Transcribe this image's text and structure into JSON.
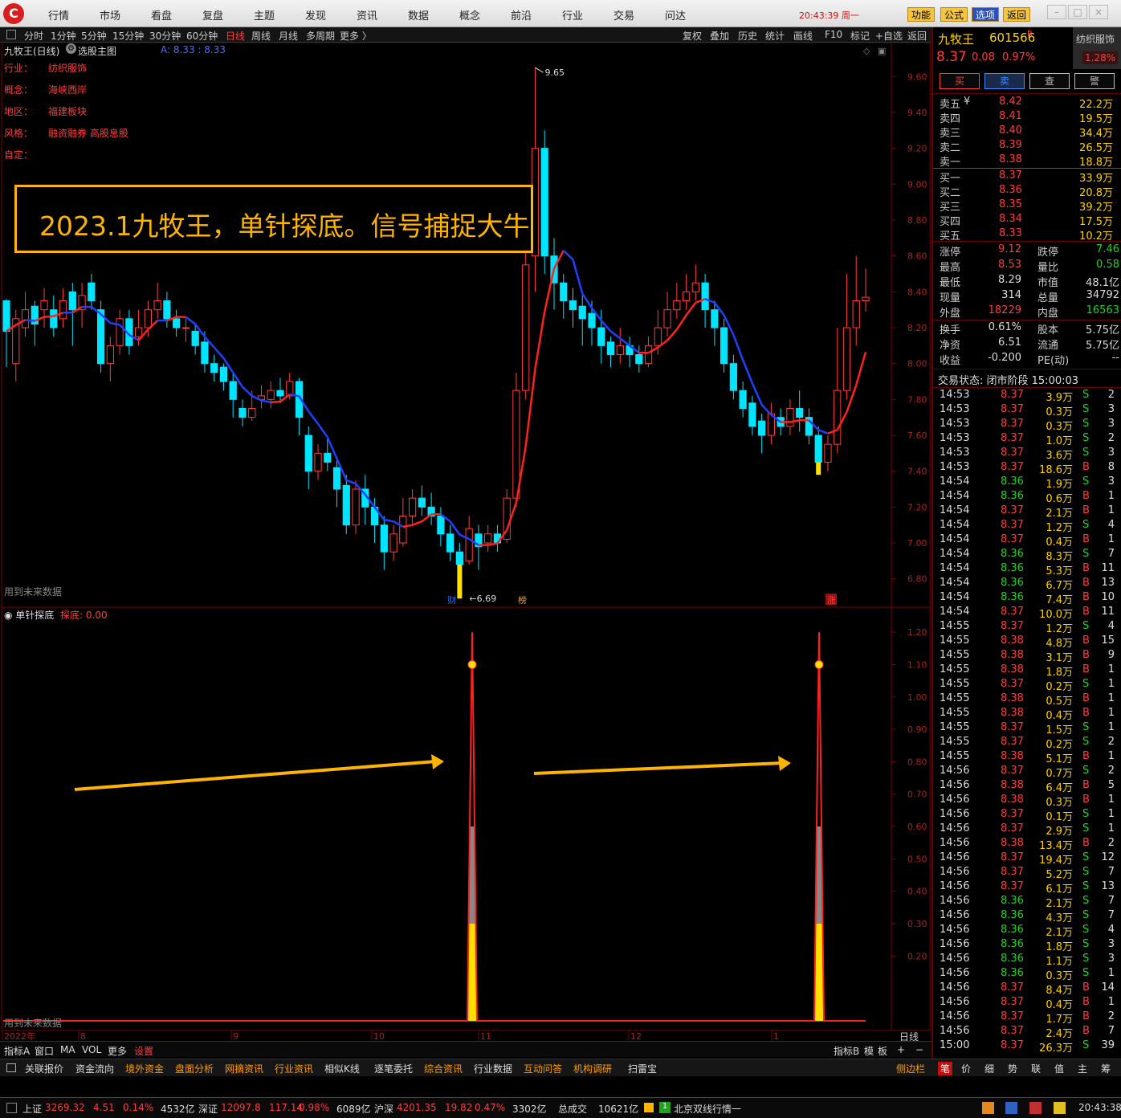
{
  "menu": [
    "行情",
    "市场",
    "看盘",
    "复盘",
    "主题",
    "发现",
    "资讯",
    "数据",
    "概念",
    "前沿",
    "行业",
    "交易",
    "问达"
  ],
  "clock": "20:43:39 周一",
  "top_buttons": [
    "功能",
    "公式",
    "选项",
    "返回"
  ],
  "periods": [
    "分时",
    "1分钟",
    "5分钟",
    "15分钟",
    "30分钟",
    "60分钟",
    "日线",
    "周线",
    "月线",
    "多周期",
    "更多 〉"
  ],
  "active_period": "日线",
  "tools": [
    "复权",
    "叠加",
    "历史",
    "统计",
    "画线",
    "F10",
    "标记",
    "+自选",
    "返回"
  ],
  "chart_title": "九牧王(日线)",
  "chart_title2": "选股主图",
  "ma_label": "A: 8.33 : 8.33",
  "info": [
    {
      "k": "行业：",
      "v": "纺织服饰"
    },
    {
      "k": "概念：",
      "v": "海峡西岸"
    },
    {
      "k": "地区：",
      "v": "福建板块"
    },
    {
      "k": "风格：",
      "v": "融资融券 高股息股"
    },
    {
      "k": "自定：",
      "v": ""
    }
  ],
  "banner": "2023.1九牧王，单针探底。信号捕捉大牛",
  "high_label": "9.65",
  "low_label": "6.69",
  "future_note": "用到未来数据",
  "markers": {
    "cai": "财",
    "bang": "榜",
    "zhang": "涨"
  },
  "ind_title": "单针探底",
  "ind_value": "探底: 0.00",
  "price_ticks": [
    "9.60",
    "9.40",
    "9.20",
    "9.00",
    "8.80",
    "8.60",
    "8.40",
    "8.20",
    "8.00",
    "7.80",
    "7.60",
    "7.40",
    "7.20",
    "7.00",
    "6.80"
  ],
  "ind_ticks": [
    "1.20",
    "1.10",
    "1.00",
    "0.90",
    "0.80",
    "0.70",
    "0.60",
    "0.50",
    "0.40",
    "0.30",
    "0.20"
  ],
  "x_labels": [
    "2022年",
    "8",
    "9",
    "10",
    "11",
    "12",
    "1"
  ],
  "period_label": "日线",
  "stock": {
    "name": "九牧王",
    "code": "601566",
    "r": "R",
    "sector": "纺织服饰",
    "price": "8.37",
    "chg": "0.08",
    "pct": "0.97%",
    "pct2": "1.28%"
  },
  "trade_buttons": [
    "买",
    "卖",
    "查",
    "警"
  ],
  "asks": [
    {
      "l": "卖五",
      "p": "8.42",
      "v": "22.2万"
    },
    {
      "l": "卖四",
      "p": "8.41",
      "v": "19.5万"
    },
    {
      "l": "卖三",
      "p": "8.40",
      "v": "34.4万"
    },
    {
      "l": "卖二",
      "p": "8.39",
      "v": "26.5万"
    },
    {
      "l": "卖一",
      "p": "8.38",
      "v": "18.8万"
    }
  ],
  "yen": "¥",
  "bids": [
    {
      "l": "买一",
      "p": "8.37",
      "v": "33.9万"
    },
    {
      "l": "买二",
      "p": "8.36",
      "v": "20.8万"
    },
    {
      "l": "买三",
      "p": "8.35",
      "v": "39.2万"
    },
    {
      "l": "买四",
      "p": "8.34",
      "v": "17.5万"
    },
    {
      "l": "买五",
      "p": "8.33",
      "v": "10.2万"
    }
  ],
  "stats": [
    [
      {
        "l": "涨停",
        "v": "9.12",
        "c": "red"
      },
      {
        "l": "跌停",
        "v": "7.46",
        "c": "green"
      }
    ],
    [
      {
        "l": "最高",
        "v": "8.53",
        "c": "red"
      },
      {
        "l": "量比",
        "v": "0.58",
        "c": "green"
      }
    ],
    [
      {
        "l": "最低",
        "v": "8.29",
        "c": "white"
      },
      {
        "l": "市值",
        "v": "48.1亿",
        "c": "white"
      }
    ],
    [
      {
        "l": "现量",
        "v": "314",
        "c": "white"
      },
      {
        "l": "总量",
        "v": "34792",
        "c": "white"
      }
    ],
    [
      {
        "l": "外盘",
        "v": "18229",
        "c": "red"
      },
      {
        "l": "内盘",
        "v": "16563",
        "c": "green"
      }
    ],
    [
      {
        "l": "换手",
        "v": "0.61%",
        "c": "white"
      },
      {
        "l": "股本",
        "v": "5.75亿",
        "c": "white"
      }
    ],
    [
      {
        "l": "净资",
        "v": "6.51",
        "c": "white"
      },
      {
        "l": "流通",
        "v": "5.75亿",
        "c": "white"
      }
    ],
    [
      {
        "l": "收益",
        "v": "-0.200",
        "c": "white"
      },
      {
        "l": "PE(动)",
        "v": "--",
        "c": "white"
      }
    ]
  ],
  "trade_state": "交易状态: 闭市阶段 15:00:03",
  "ticks": [
    [
      "14:53",
      "8.37",
      "3.9万",
      "S",
      "2"
    ],
    [
      "14:53",
      "8.37",
      "0.3万",
      "S",
      "3"
    ],
    [
      "14:53",
      "8.37",
      "0.3万",
      "S",
      "3"
    ],
    [
      "14:53",
      "8.37",
      "1.0万",
      "S",
      "2"
    ],
    [
      "14:53",
      "8.37",
      "3.6万",
      "S",
      "3"
    ],
    [
      "14:53",
      "8.37",
      "18.6万",
      "B",
      "8"
    ],
    [
      "14:54",
      "8.36",
      "1.9万",
      "S",
      "3"
    ],
    [
      "14:54",
      "8.36",
      "0.6万",
      "B",
      "1"
    ],
    [
      "14:54",
      "8.37",
      "2.1万",
      "B",
      "1"
    ],
    [
      "14:54",
      "8.37",
      "1.2万",
      "S",
      "4"
    ],
    [
      "14:54",
      "8.37",
      "0.4万",
      "B",
      "1"
    ],
    [
      "14:54",
      "8.36",
      "8.3万",
      "S",
      "7"
    ],
    [
      "14:54",
      "8.36",
      "5.3万",
      "B",
      "11"
    ],
    [
      "14:54",
      "8.36",
      "6.7万",
      "B",
      "13"
    ],
    [
      "14:54",
      "8.36",
      "7.4万",
      "B",
      "10"
    ],
    [
      "14:54",
      "8.37",
      "10.0万",
      "B",
      "11"
    ],
    [
      "14:55",
      "8.37",
      "1.2万",
      "S",
      "4"
    ],
    [
      "14:55",
      "8.38",
      "4.8万",
      "B",
      "15"
    ],
    [
      "14:55",
      "8.38",
      "3.1万",
      "B",
      "9"
    ],
    [
      "14:55",
      "8.38",
      "1.8万",
      "B",
      "1"
    ],
    [
      "14:55",
      "8.37",
      "0.2万",
      "S",
      "1"
    ],
    [
      "14:55",
      "8.38",
      "0.5万",
      "B",
      "1"
    ],
    [
      "14:55",
      "8.38",
      "0.4万",
      "B",
      "1"
    ],
    [
      "14:55",
      "8.37",
      "1.5万",
      "S",
      "1"
    ],
    [
      "14:55",
      "8.37",
      "0.2万",
      "S",
      "2"
    ],
    [
      "14:55",
      "8.38",
      "5.1万",
      "B",
      "1"
    ],
    [
      "14:56",
      "8.37",
      "0.7万",
      "S",
      "2"
    ],
    [
      "14:56",
      "8.38",
      "6.4万",
      "B",
      "5"
    ],
    [
      "14:56",
      "8.38",
      "0.3万",
      "B",
      "1"
    ],
    [
      "14:56",
      "8.37",
      "0.1万",
      "S",
      "1"
    ],
    [
      "14:56",
      "8.37",
      "2.9万",
      "S",
      "1"
    ],
    [
      "14:56",
      "8.38",
      "13.4万",
      "B",
      "2"
    ],
    [
      "14:56",
      "8.37",
      "19.4万",
      "S",
      "12"
    ],
    [
      "14:56",
      "8.37",
      "5.2万",
      "S",
      "7"
    ],
    [
      "14:56",
      "8.37",
      "6.1万",
      "S",
      "13"
    ],
    [
      "14:56",
      "8.36",
      "2.1万",
      "S",
      "7"
    ],
    [
      "14:56",
      "8.36",
      "4.3万",
      "S",
      "7"
    ],
    [
      "14:56",
      "8.36",
      "2.1万",
      "S",
      "4"
    ],
    [
      "14:56",
      "8.36",
      "1.8万",
      "S",
      "3"
    ],
    [
      "14:56",
      "8.36",
      "1.1万",
      "S",
      "3"
    ],
    [
      "14:56",
      "8.36",
      "0.3万",
      "S",
      "1"
    ],
    [
      "14:56",
      "8.37",
      "8.4万",
      "B",
      "14"
    ],
    [
      "14:56",
      "8.37",
      "0.4万",
      "B",
      "1"
    ],
    [
      "14:56",
      "8.37",
      "1.7万",
      "B",
      "2"
    ],
    [
      "14:56",
      "8.37",
      "2.4万",
      "B",
      "7"
    ],
    [
      "15:00",
      "8.37",
      "26.3万",
      "S",
      "39"
    ]
  ],
  "bottom_left": [
    "指标A",
    "窗口",
    "MA",
    "VOL",
    "更多",
    "设置"
  ],
  "bottom_right": [
    "指标B",
    "模",
    "板",
    "+",
    "−"
  ],
  "nav_tabs": [
    "关联报价",
    "资金流向",
    "境外资金",
    "盘面分析",
    "网摘资讯",
    "行业资讯",
    "相似K线",
    "逐笔委托",
    "综合资讯",
    "行业数据",
    "互动问答",
    "机构调研",
    "扫雷宝"
  ],
  "sidebar_btn": "侧边栏",
  "right_tabs": [
    "笔",
    "价",
    "细",
    "势",
    "联",
    "值",
    "主",
    "筹"
  ],
  "indices": [
    {
      "n": "上证",
      "v": "3269.32",
      "d": "4.51",
      "p": "0.14%",
      "a": "4532亿"
    },
    {
      "n": "深证",
      "v": "12097.8",
      "d": "117.14",
      "p": "0.98%",
      "a": "6089亿"
    },
    {
      "n": "沪深",
      "v": "4201.35",
      "d": "19.82",
      "p": "0.47%",
      "a": "3302亿"
    }
  ],
  "total_label": "总成交",
  "total_val": "10621亿",
  "ticker": "北京双线行情一",
  "status_time": "20:43:38",
  "chart_data": {
    "type": "candlestick",
    "pane_price": {
      "ymin": 6.7,
      "ymax": 9.7
    },
    "pane_indicator": {
      "ymin": 0,
      "ymax": 1.24
    },
    "candles": [
      [
        8.35,
        8.18,
        7.98,
        8.36
      ],
      [
        8.0,
        8.25,
        7.9,
        8.3
      ],
      [
        8.2,
        8.3,
        8.15,
        8.4
      ],
      [
        8.32,
        8.22,
        8.1,
        8.35
      ],
      [
        8.3,
        8.35,
        8.2,
        8.42
      ],
      [
        8.3,
        8.2,
        8.15,
        8.38
      ],
      [
        8.25,
        8.35,
        8.2,
        8.42
      ],
      [
        8.4,
        8.3,
        8.1,
        8.45
      ],
      [
        8.3,
        8.38,
        8.2,
        8.45
      ],
      [
        8.45,
        8.35,
        8.3,
        8.5
      ],
      [
        8.3,
        8.0,
        7.95,
        8.35
      ],
      [
        8.0,
        8.1,
        7.9,
        8.15
      ],
      [
        8.1,
        8.25,
        8.05,
        8.3
      ],
      [
        8.25,
        8.1,
        8.05,
        8.3
      ],
      [
        8.15,
        8.2,
        8.1,
        8.3
      ],
      [
        8.2,
        8.3,
        8.15,
        8.35
      ],
      [
        8.3,
        8.35,
        8.25,
        8.45
      ],
      [
        8.35,
        8.25,
        8.2,
        8.4
      ],
      [
        8.25,
        8.2,
        8.15,
        8.3
      ],
      [
        8.2,
        8.2,
        8.12,
        8.25
      ],
      [
        8.18,
        8.1,
        8.05,
        8.22
      ],
      [
        8.12,
        8.0,
        7.95,
        8.18
      ],
      [
        8.0,
        7.95,
        7.9,
        8.05
      ],
      [
        7.98,
        7.9,
        7.85,
        8.0
      ],
      [
        7.9,
        7.8,
        7.7,
        7.95
      ],
      [
        7.75,
        7.7,
        7.65,
        7.8
      ],
      [
        7.7,
        7.75,
        7.68,
        7.85
      ],
      [
        7.8,
        7.82,
        7.75,
        7.88
      ],
      [
        7.8,
        7.85,
        7.75,
        7.9
      ],
      [
        7.85,
        7.82,
        7.78,
        7.92
      ],
      [
        7.82,
        7.9,
        7.8,
        7.95
      ],
      [
        7.9,
        7.7,
        7.6,
        7.92
      ],
      [
        7.6,
        7.4,
        7.3,
        7.65
      ],
      [
        7.4,
        7.5,
        7.35,
        7.55
      ],
      [
        7.5,
        7.45,
        7.4,
        7.58
      ],
      [
        7.42,
        7.3,
        7.2,
        7.48
      ],
      [
        7.32,
        7.1,
        7.05,
        7.38
      ],
      [
        7.1,
        7.3,
        7.05,
        7.35
      ],
      [
        7.3,
        7.2,
        7.1,
        7.38
      ],
      [
        7.2,
        7.1,
        7.0,
        7.25
      ],
      [
        7.1,
        6.95,
        6.85,
        7.15
      ],
      [
        6.95,
        7.05,
        6.9,
        7.1
      ],
      [
        7.0,
        7.15,
        6.98,
        7.25
      ],
      [
        7.15,
        7.25,
        7.1,
        7.3
      ],
      [
        7.25,
        7.2,
        7.15,
        7.32
      ],
      [
        7.2,
        7.15,
        7.1,
        7.28
      ],
      [
        7.15,
        7.05,
        6.98,
        7.2
      ],
      [
        7.05,
        6.95,
        6.9,
        7.1
      ],
      [
        6.95,
        6.88,
        6.8,
        7.0
      ],
      [
        6.9,
        7.08,
        6.88,
        7.15
      ],
      [
        7.05,
        6.98,
        6.85,
        7.1
      ],
      [
        7.0,
        7.05,
        6.95,
        7.1
      ],
      [
        7.05,
        7.0,
        6.95,
        7.1
      ],
      [
        7.02,
        7.25,
        7.0,
        7.3
      ],
      [
        7.25,
        7.85,
        7.2,
        7.95
      ],
      [
        7.85,
        8.55,
        7.8,
        8.65
      ],
      [
        8.6,
        9.2,
        8.4,
        9.65
      ],
      [
        9.2,
        8.6,
        8.5,
        9.3
      ],
      [
        8.6,
        8.45,
        8.3,
        8.7
      ],
      [
        8.45,
        8.35,
        8.25,
        8.5
      ],
      [
        8.35,
        8.3,
        8.2,
        8.42
      ],
      [
        8.32,
        8.25,
        8.1,
        8.38
      ],
      [
        8.28,
        8.2,
        8.1,
        8.35
      ],
      [
        8.2,
        8.1,
        8.0,
        8.3
      ],
      [
        8.12,
        8.05,
        7.98,
        8.15
      ],
      [
        8.05,
        8.1,
        8.0,
        8.2
      ],
      [
        8.1,
        8.05,
        7.98,
        8.15
      ],
      [
        8.05,
        8.0,
        7.95,
        8.1
      ],
      [
        8.0,
        8.1,
        7.98,
        8.15
      ],
      [
        8.1,
        8.2,
        8.05,
        8.3
      ],
      [
        8.2,
        8.3,
        8.15,
        8.4
      ],
      [
        8.3,
        8.35,
        8.25,
        8.45
      ],
      [
        8.35,
        8.4,
        8.3,
        8.5
      ],
      [
        8.4,
        8.45,
        8.35,
        8.55
      ],
      [
        8.45,
        8.3,
        8.2,
        8.5
      ],
      [
        8.3,
        8.2,
        8.1,
        8.35
      ],
      [
        8.2,
        8.0,
        7.95,
        8.25
      ],
      [
        8.0,
        7.85,
        7.8,
        8.05
      ],
      [
        7.85,
        7.75,
        7.7,
        7.9
      ],
      [
        7.78,
        7.65,
        7.6,
        7.82
      ],
      [
        7.68,
        7.6,
        7.5,
        7.72
      ],
      [
        7.6,
        7.72,
        7.55,
        7.78
      ],
      [
        7.7,
        7.65,
        7.6,
        7.75
      ],
      [
        7.65,
        7.75,
        7.6,
        7.8
      ],
      [
        7.75,
        7.7,
        7.62,
        7.85
      ],
      [
        7.7,
        7.6,
        7.55,
        7.75
      ],
      [
        7.6,
        7.45,
        7.4,
        7.65
      ],
      [
        7.45,
        7.55,
        7.4,
        7.6
      ],
      [
        7.55,
        7.85,
        7.5,
        8.2
      ],
      [
        7.85,
        8.2,
        7.8,
        8.5
      ],
      [
        8.2,
        8.35,
        8.1,
        8.6
      ],
      [
        8.35,
        8.37,
        8.29,
        8.53
      ]
    ],
    "indicator_signals": [
      {
        "bar": "low_pin_oct",
        "value": 1.2
      },
      {
        "bar": "low_pin_jan",
        "value": 1.2
      }
    ]
  }
}
